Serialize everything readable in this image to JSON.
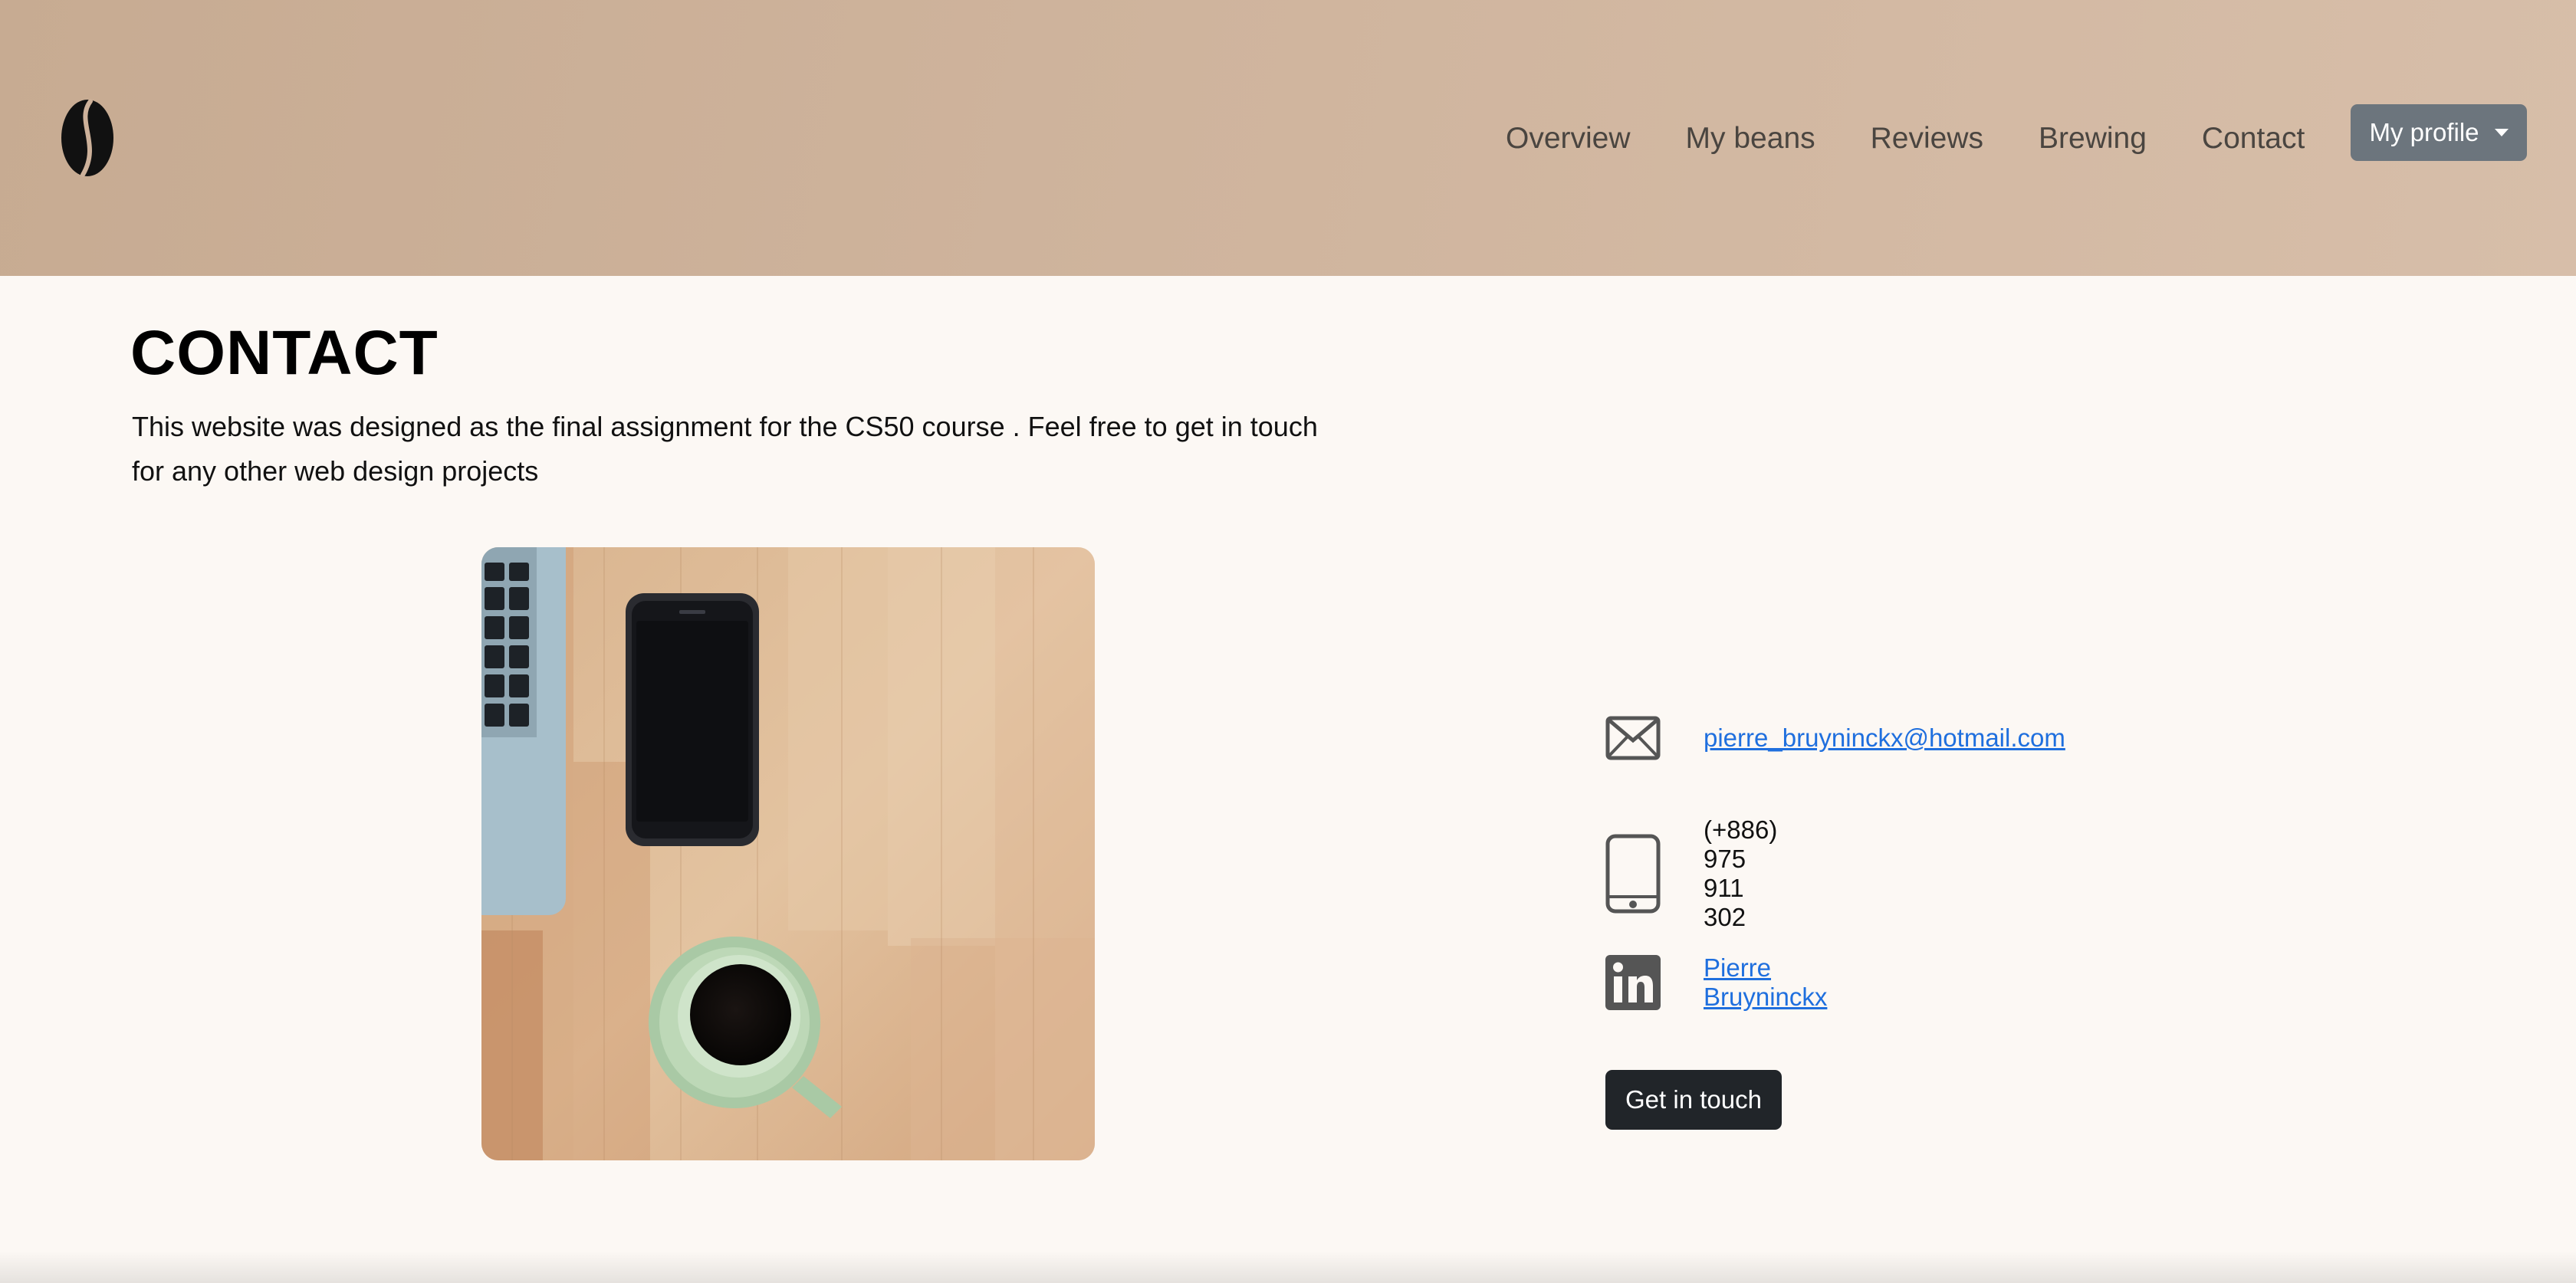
{
  "header": {
    "logo_icon": "coffee-bean-icon",
    "nav": [
      {
        "label": "Overview"
      },
      {
        "label": "My beans"
      },
      {
        "label": "Reviews"
      },
      {
        "label": "Brewing"
      },
      {
        "label": "Contact"
      }
    ],
    "profile_button": "My profile"
  },
  "main": {
    "title": "CONTACT",
    "intro": "This website was designed as the final assignment for the CS50 course . Feel free to get in touch for any other web design projects",
    "photo_icon": "desk-photo-laptop-phone-coffee",
    "contacts": {
      "email": {
        "icon": "envelope-icon",
        "text": "pierre_bruyninckx@hotmail.com"
      },
      "phone": {
        "icon": "phone-icon",
        "text": "(+886) 975 911 302"
      },
      "linkedin": {
        "icon": "linkedin-icon",
        "text": "Pierre Bruyninckx"
      }
    },
    "cta_button": "Get in touch"
  },
  "colors": {
    "header_bg": "#cdb19a",
    "page_bg": "#fcf8f4",
    "link": "#1f6fde",
    "profile_btn": "#6c757d",
    "cta_btn": "#212529"
  }
}
